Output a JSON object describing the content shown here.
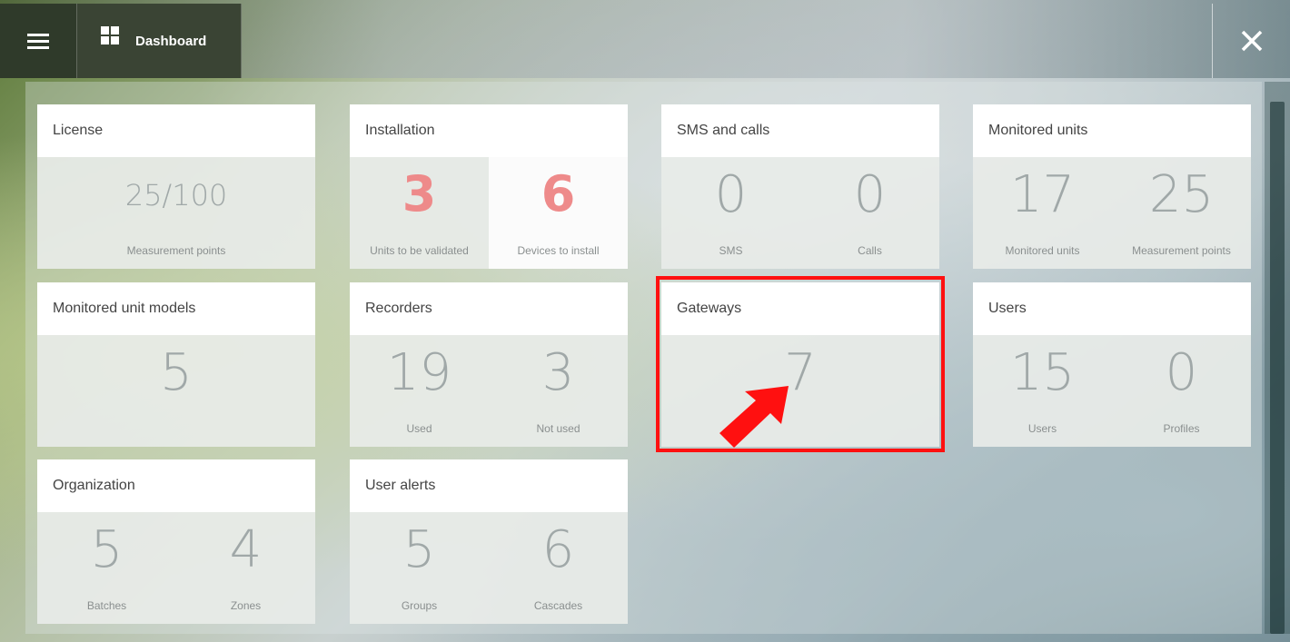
{
  "header": {
    "title": "Dashboard"
  },
  "cards": {
    "license": {
      "title": "License",
      "value": "25/100",
      "label": "Measurement points"
    },
    "installation": {
      "title": "Installation",
      "left": {
        "value": "3",
        "label": "Units to be validated"
      },
      "right": {
        "value": "6",
        "label": "Devices to install"
      }
    },
    "sms_calls": {
      "title": "SMS and calls",
      "left": {
        "value": "0",
        "label": "SMS"
      },
      "right": {
        "value": "0",
        "label": "Calls"
      }
    },
    "monitored_units": {
      "title": "Monitored units",
      "left": {
        "value": "17",
        "label": "Monitored units"
      },
      "right": {
        "value": "25",
        "label": "Measurement points"
      }
    },
    "monitored_unit_models": {
      "title": "Monitored unit models",
      "value": "5"
    },
    "recorders": {
      "title": "Recorders",
      "left": {
        "value": "19",
        "label": "Used"
      },
      "right": {
        "value": "3",
        "label": "Not used"
      }
    },
    "gateways": {
      "title": "Gateways",
      "value": "7"
    },
    "users": {
      "title": "Users",
      "left": {
        "value": "15",
        "label": "Users"
      },
      "right": {
        "value": "0",
        "label": "Profiles"
      }
    },
    "organization": {
      "title": "Organization",
      "left": {
        "value": "5",
        "label": "Batches"
      },
      "right": {
        "value": "4",
        "label": "Zones"
      }
    },
    "user_alerts": {
      "title": "User alerts",
      "left": {
        "value": "5",
        "label": "Groups"
      },
      "right": {
        "value": "6",
        "label": "Cascades"
      }
    }
  },
  "colors": {
    "highlight": "#ff1010",
    "installation_accent": "#ee8a8a"
  }
}
